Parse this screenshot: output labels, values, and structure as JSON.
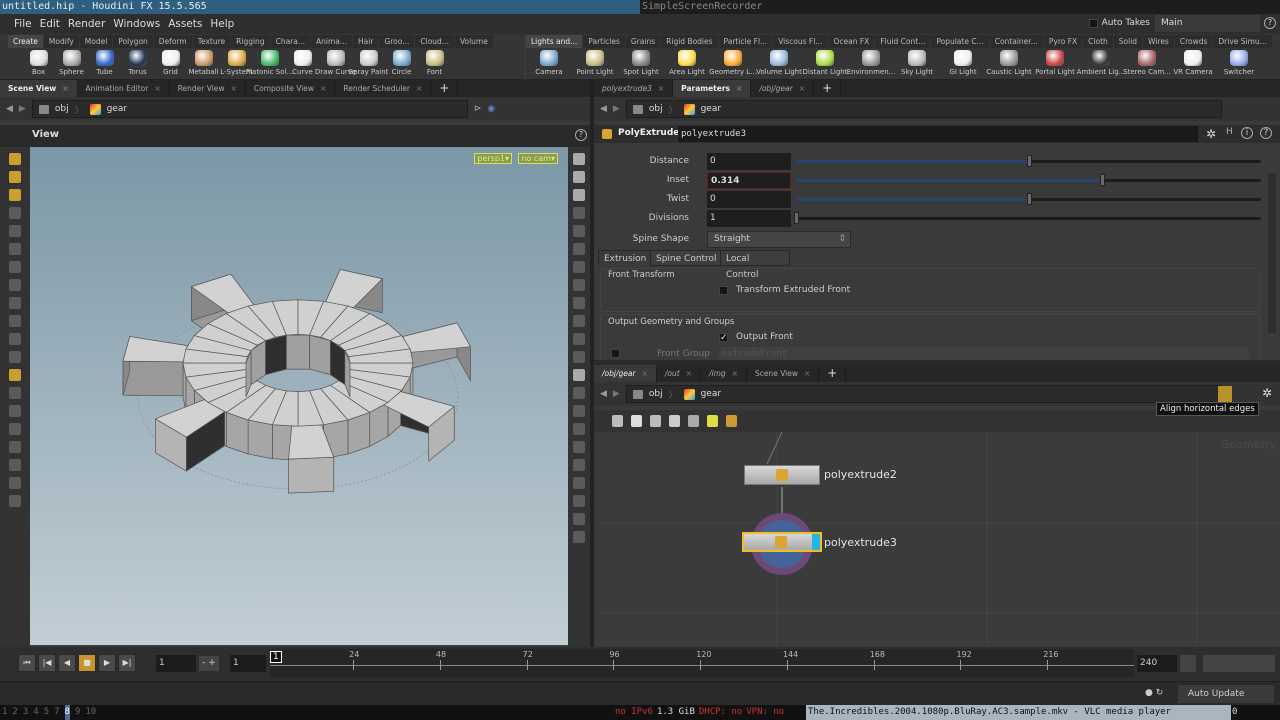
{
  "window": {
    "title": "untitled.hip - Houdini FX 15.5.565",
    "other_window": "SimpleScreenRecorder"
  },
  "menu": [
    "File",
    "Edit",
    "Render",
    "Windows",
    "Assets",
    "Help"
  ],
  "takes": {
    "auto_takes": "Auto Takes",
    "current": "Main"
  },
  "shelf_left": {
    "tabs": [
      "Create",
      "Modify",
      "Model",
      "Polygon",
      "Deform",
      "Texture",
      "Rigging",
      "Chara...",
      "Anima...",
      "Hair",
      "Groo...",
      "Cloud...",
      "Volume"
    ],
    "tools": [
      "Box",
      "Sphere",
      "Tube",
      "Torus",
      "Grid",
      "Metaball",
      "L-System",
      "Platonic Sol...",
      "Curve",
      "Draw Curve",
      "Spray Paint",
      "Circle",
      "Font"
    ]
  },
  "shelf_right": {
    "tabs": [
      "Lights and...",
      "Particles",
      "Grains",
      "Rigid Bodies",
      "Particle Fl...",
      "Viscous Fl...",
      "Ocean FX",
      "Fluid Cont...",
      "Populate C...",
      "Container...",
      "Pyro FX",
      "Cloth",
      "Solid",
      "Wires",
      "Crowds",
      "Drive Simu..."
    ],
    "tools": [
      "Camera",
      "Point Light",
      "Spot Light",
      "Area Light",
      "Geometry L...",
      "Volume Light",
      "Distant Light",
      "Environmen...",
      "Sky Light",
      "GI Light",
      "Caustic Light",
      "Portal Light",
      "Ambient Lig...",
      "Stereo Cam...",
      "VR Camera",
      "Switcher"
    ]
  },
  "left_pane": {
    "tabs": [
      "Scene View",
      "Animation Editor",
      "Render View",
      "Composite View",
      "Render Scheduler"
    ],
    "path": [
      "obj",
      "gear"
    ],
    "view_title": "View",
    "camera_menu": "persp1",
    "cam_menu": "no cam"
  },
  "params_pane": {
    "tabs": [
      "polyextrude3",
      "Parameters",
      "/obj/gear"
    ],
    "path": [
      "obj",
      "gear"
    ],
    "node_type": "PolyExtrude",
    "node_name": "polyextrude3",
    "params": [
      {
        "label": "Distance",
        "value": "0",
        "fraction": 0.5
      },
      {
        "label": "Inset",
        "value": "0.314",
        "fraction": 0.657
      },
      {
        "label": "Twist",
        "value": "0",
        "fraction": 0.5
      },
      {
        "label": "Divisions",
        "value": "1",
        "fraction": 0.0
      }
    ],
    "spine_shape": {
      "label": "Spine Shape",
      "value": "Straight"
    },
    "subtabs": [
      "Extrusion",
      "Spine Control",
      "Local Control"
    ],
    "front_transform": {
      "heading": "Front Transform",
      "checkbox": "Transform Extruded Front",
      "checked": false
    },
    "output": {
      "heading": "Output Geometry and Groups",
      "checkbox": "Output Front",
      "checked": true,
      "group_label": "Front Group",
      "group_value": "extrudeFront"
    }
  },
  "network_pane": {
    "tabs": [
      "/obj/gear",
      "/out",
      "/img",
      "Scene View"
    ],
    "path": [
      "obj",
      "gear"
    ],
    "tooltip": "Align horizontal edges",
    "watermark": "Geometry",
    "nodes": [
      "polyextrude2",
      "polyextrude3"
    ]
  },
  "timeline": {
    "current_frame": "1",
    "start": "1",
    "step": "1",
    "end": "240",
    "ticks": [
      "24",
      "48",
      "72",
      "96",
      "120",
      "144",
      "168",
      "192",
      "216"
    ],
    "marker": "1",
    "auto_update": "Auto Update"
  },
  "taskbar": {
    "workspaces": [
      "1",
      "2",
      "3",
      "4",
      "5",
      "7",
      "8",
      "9",
      "10"
    ],
    "active_workspace": "8",
    "status": [
      "no IPv6",
      "1.3 GiB",
      "DHCP: no",
      "VPN: no"
    ],
    "window": "The.Incredibles.2004.1080p.BluRay.AC3.sample.mkv - VLC media player",
    "clock": "0"
  }
}
